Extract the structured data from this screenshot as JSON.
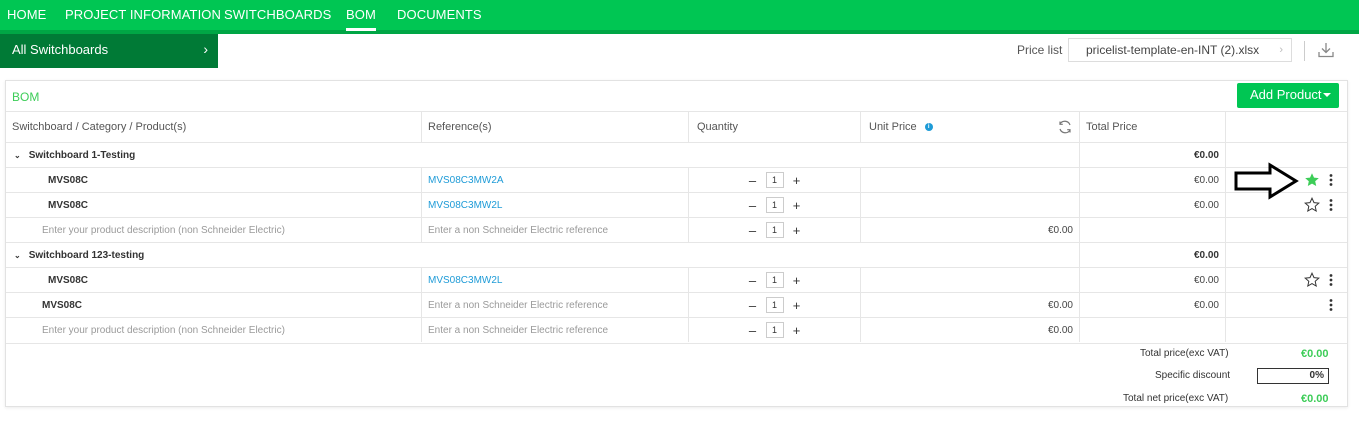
{
  "nav": {
    "items": [
      "HOME",
      "PROJECT INFORMATION",
      "SWITCHBOARDS",
      "BOM",
      "DOCUMENTS"
    ],
    "active": "BOM"
  },
  "subbar": {
    "all_switchboards": "All Switchboards",
    "price_list_label": "Price list",
    "price_list_value": "pricelist-template-en-INT (2).xlsx"
  },
  "bom": {
    "title": "BOM",
    "add_product": "Add Product",
    "headers": {
      "product": "Switchboard / Category / Product(s)",
      "reference": "Reference(s)",
      "quantity": "Quantity",
      "unit_price": "Unit Price",
      "total_price": "Total Price"
    },
    "groups": [
      {
        "name": "Switchboard 1-Testing",
        "total": "€0.00",
        "rows": [
          {
            "product": "MVS08C",
            "reference": "MVS08C3MW2A",
            "qty": "1",
            "unit_price": "",
            "total": "€0.00",
            "star": "filled"
          },
          {
            "product": "MVS08C",
            "reference": "MVS08C3MW2L",
            "qty": "1",
            "unit_price": "",
            "total": "€0.00",
            "star": "outline"
          },
          {
            "product_placeholder": "Enter your product description (non Schneider Electric)",
            "reference_placeholder": "Enter a non Schneider Electric reference",
            "qty": "1",
            "unit_price": "€0.00",
            "total": ""
          }
        ]
      },
      {
        "name": "Switchboard 123-testing",
        "total": "€0.00",
        "rows": [
          {
            "product": "MVS08C",
            "reference": "MVS08C3MW2L",
            "qty": "1",
            "unit_price": "",
            "total": "€0.00",
            "star": "outline"
          },
          {
            "product": "MVS08C",
            "reference_placeholder": "Enter a non Schneider Electric reference",
            "qty": "1",
            "unit_price": "€0.00",
            "total": "€0.00"
          },
          {
            "product_placeholder": "Enter your product description (non Schneider Electric)",
            "reference_placeholder": "Enter a non Schneider Electric reference",
            "qty": "1",
            "unit_price": "€0.00",
            "total": ""
          }
        ]
      }
    ],
    "summary": {
      "total_price_label": "Total price(exc VAT)",
      "total_price": "€0.00",
      "discount_label": "Specific discount",
      "discount": "0%",
      "net_price_label": "Total net price(exc VAT)",
      "net_price": "€0.00"
    }
  },
  "colors": {
    "brand_green": "#00c653",
    "dark_green": "#007a36",
    "link_blue": "#1e9bd7",
    "price_green": "#3dcd58"
  }
}
